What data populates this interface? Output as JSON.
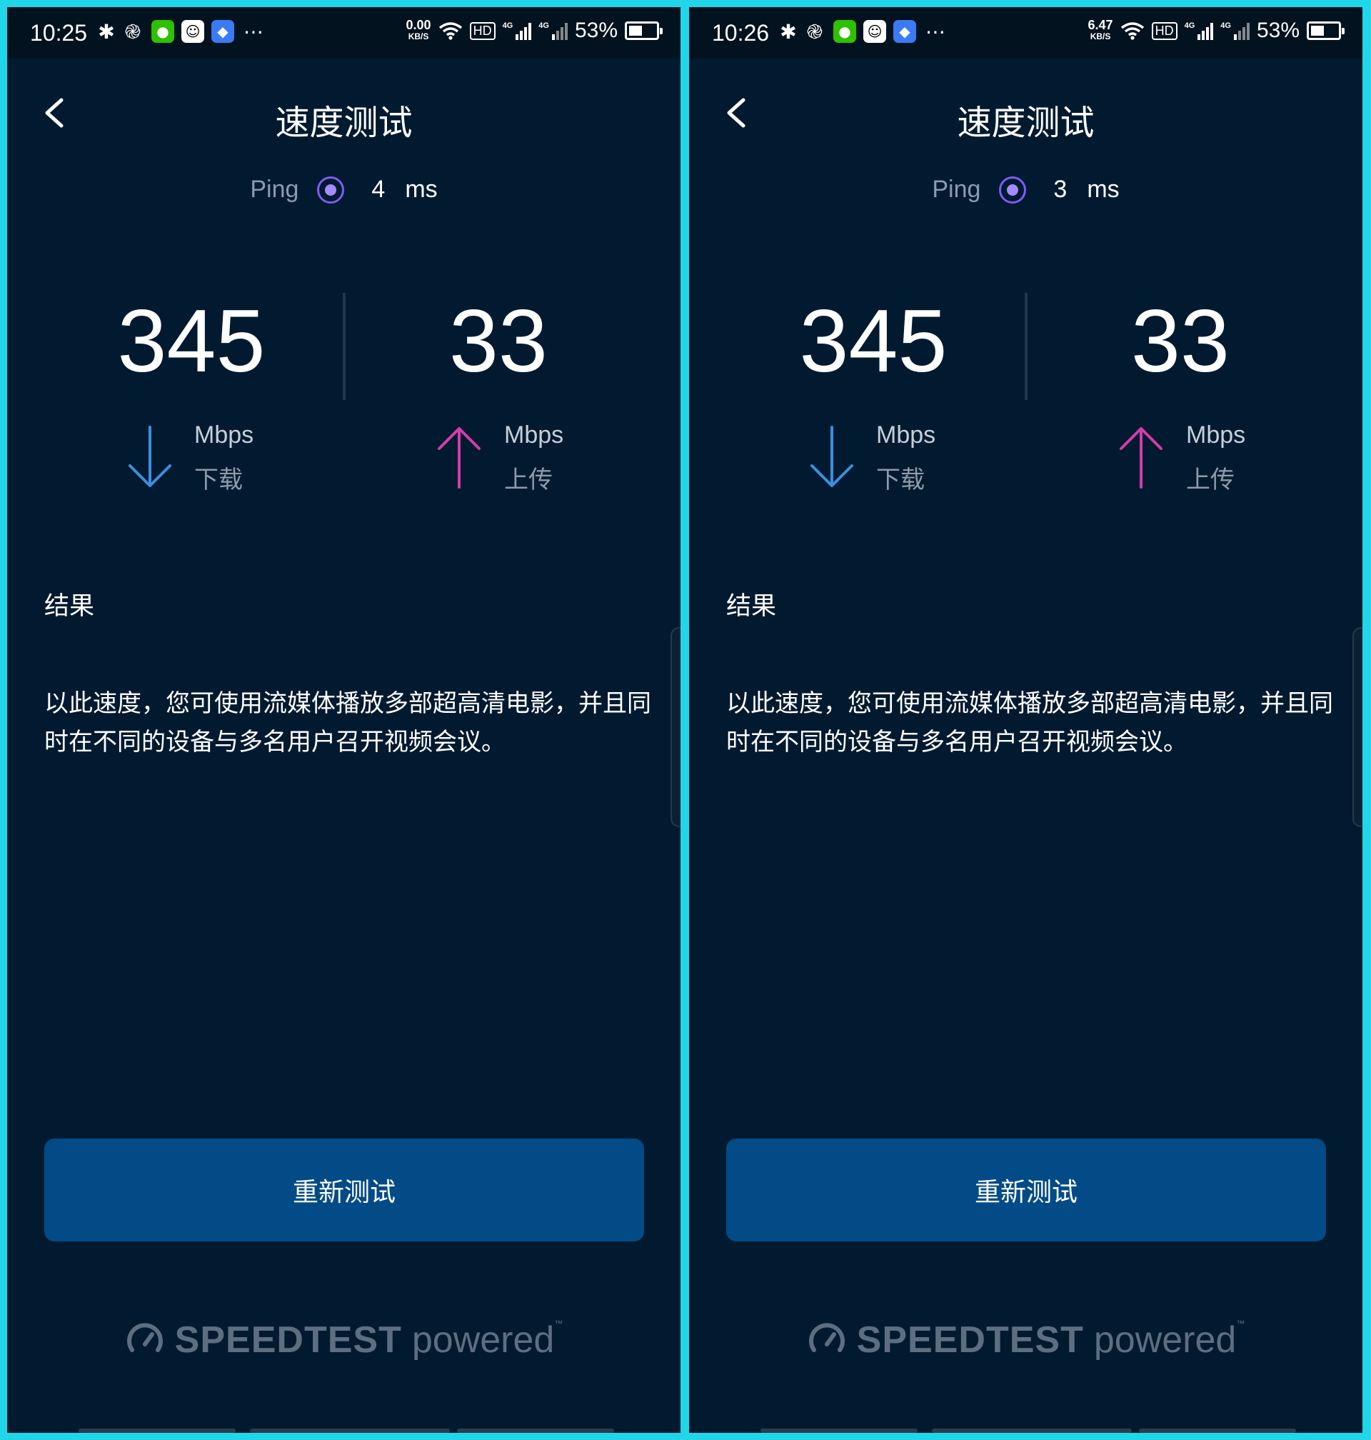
{
  "screens": [
    {
      "status_bar": {
        "time": "10:25",
        "net_speed": "0.00",
        "net_unit": "KB/S",
        "hd_label": "HD",
        "sim1_label": "4G",
        "sim2_label": "4G",
        "battery_text": "53%",
        "battery_level": 0.53,
        "icons": [
          "bluetooth-icon",
          "swirl-app-icon",
          "wechat-icon",
          "qq-icon",
          "shield-icon",
          "more-icon",
          "wifi-icon",
          "signal-icon",
          "battery-icon"
        ]
      },
      "title": "速度测试",
      "ping": {
        "label": "Ping",
        "value": "4",
        "unit": "ms"
      },
      "download": {
        "value": "345",
        "unit": "Mbps",
        "label": "下载"
      },
      "upload": {
        "value": "33",
        "unit": "Mbps",
        "label": "上传"
      },
      "result": {
        "heading": "结果",
        "text": "以此速度，您可使用流媒体播放多部超高清电影，并且同时在不同的设备与多名用户召开视频会议。"
      },
      "retest_button": "重新测试",
      "brand": {
        "name": "SPEEDTEST",
        "suffix": "powered"
      }
    },
    {
      "status_bar": {
        "time": "10:26",
        "net_speed": "6.47",
        "net_unit": "KB/S",
        "hd_label": "HD",
        "sim1_label": "4G",
        "sim2_label": "4G",
        "battery_text": "53%",
        "battery_level": 0.53,
        "icons": [
          "bluetooth-icon",
          "swirl-app-icon",
          "wechat-icon",
          "qq-icon",
          "shield-icon",
          "more-icon",
          "wifi-icon",
          "signal-icon",
          "battery-icon"
        ]
      },
      "title": "速度测试",
      "ping": {
        "label": "Ping",
        "value": "3",
        "unit": "ms"
      },
      "download": {
        "value": "345",
        "unit": "Mbps",
        "label": "下载"
      },
      "upload": {
        "value": "33",
        "unit": "Mbps",
        "label": "上传"
      },
      "result": {
        "heading": "结果",
        "text": "以此速度，您可使用流媒体播放多部超高清电影，并且同时在不同的设备与多名用户召开视频会议。"
      },
      "retest_button": "重新测试",
      "brand": {
        "name": "SPEEDTEST",
        "suffix": "powered"
      }
    }
  ],
  "colors": {
    "frame": "#22d6ea",
    "background": "#021a30",
    "button": "#024b87",
    "download_arrow": "#3a8fe0",
    "upload_arrow": "#d43ca8",
    "ping_icon": "#7c5cf2"
  }
}
